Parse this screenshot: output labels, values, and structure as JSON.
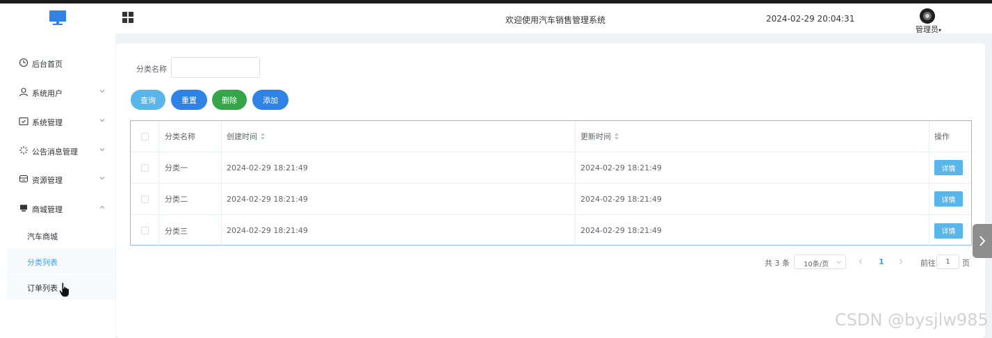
{
  "header": {
    "title": "欢迎使用汽车销售管理系统",
    "datetime": "2024-02-29 20:04:31",
    "user_label": "管理员"
  },
  "sidebar": {
    "items": [
      {
        "label": "后台首页",
        "icon": "clock-icon",
        "expandable": false
      },
      {
        "label": "系统用户",
        "icon": "user-icon",
        "expandable": true
      },
      {
        "label": "系统管理",
        "icon": "folder-check-icon",
        "expandable": true
      },
      {
        "label": "公告消息管理",
        "icon": "sun-burst-icon",
        "expandable": true
      },
      {
        "label": "资源管理",
        "icon": "box-icon",
        "expandable": true
      },
      {
        "label": "商城管理",
        "icon": "monitor-icon",
        "expandable": true,
        "expanded": true
      }
    ],
    "sub_items": [
      {
        "label": "汽车商城",
        "active": false
      },
      {
        "label": "分类列表",
        "active": true
      },
      {
        "label": "订单列表",
        "active": false
      }
    ]
  },
  "search": {
    "label": "分类名称",
    "value": "",
    "placeholder": ""
  },
  "toolbar": {
    "query_label": "查询",
    "reset_label": "重置",
    "delete_label": "删除",
    "add_label": "添加"
  },
  "table": {
    "columns": {
      "name": "分类名称",
      "created": "创建时间",
      "updated": "更新时间",
      "operation": "操作"
    },
    "rows": [
      {
        "name": "分类一",
        "created": "2024-02-29 18:21:49",
        "updated": "2024-02-29 18:21:49",
        "action": "详情"
      },
      {
        "name": "分类二",
        "created": "2024-02-29 18:21:49",
        "updated": "2024-02-29 18:21:49",
        "action": "详情"
      },
      {
        "name": "分类三",
        "created": "2024-02-29 18:21:49",
        "updated": "2024-02-29 18:21:49",
        "action": "详情"
      }
    ]
  },
  "pagination": {
    "total_text": "共 3 条",
    "page_size": "10条/页",
    "current_page": "1",
    "goto_label": "前往",
    "goto_value": "1",
    "page_suffix": "页"
  },
  "watermark": "CSDN @bysjlw985",
  "colors": {
    "accent": "#409eff",
    "query": "#58b6ea",
    "reset": "#2f82e6",
    "delete": "#35a549",
    "add": "#2f82e6"
  }
}
